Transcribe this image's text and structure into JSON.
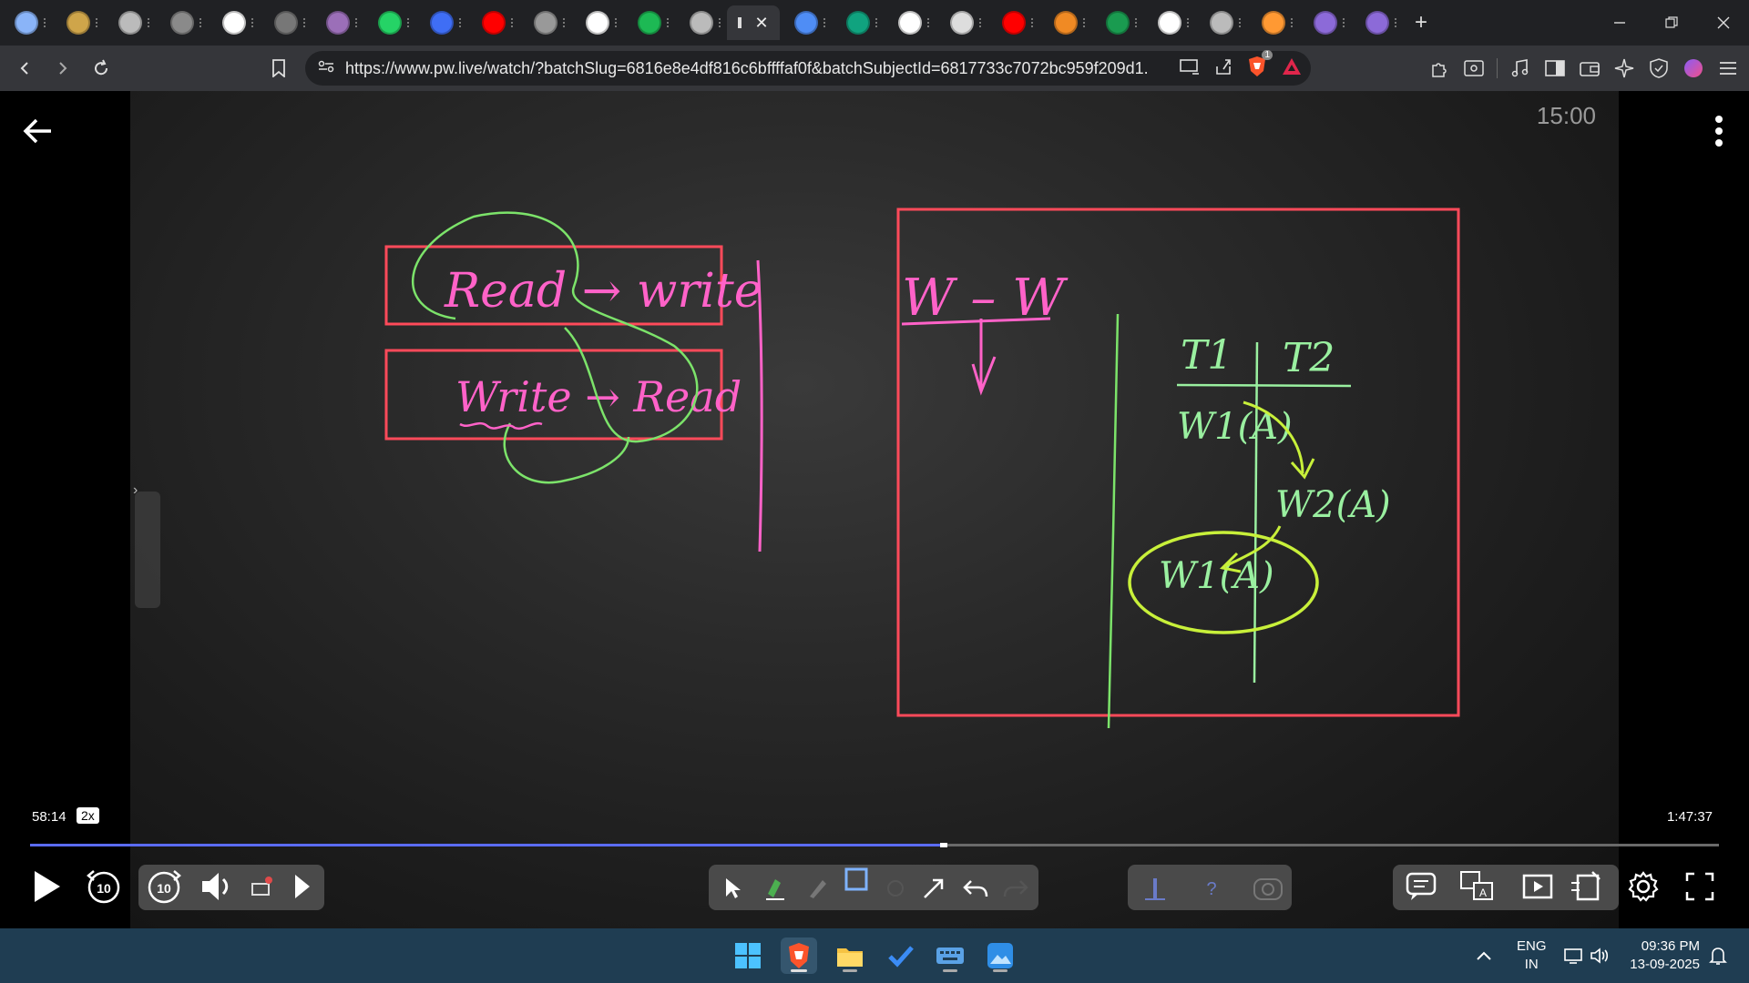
{
  "browser": {
    "tabs": [
      {
        "icon": "generic-site-icon",
        "color": "#8ab4f8"
      },
      {
        "icon": "coin-icon",
        "color": "#cfa54a"
      },
      {
        "icon": "globe-icon",
        "color": "#bbbbbb"
      },
      {
        "icon": "m-site-icon",
        "color": "#8a8a8a"
      },
      {
        "icon": "wordpress-icon",
        "color": "#ffffff"
      },
      {
        "icon": "circle-site-icon",
        "color": "#777777"
      },
      {
        "icon": "avatar-site-icon",
        "color": "#9b6fb8"
      },
      {
        "icon": "whatsapp-icon",
        "color": "#25d366"
      },
      {
        "icon": "shield-tab-icon",
        "color": "#3f6ef5"
      },
      {
        "icon": "youtube-icon",
        "color": "#ff0000"
      },
      {
        "icon": "blog-icon",
        "color": "#999999"
      },
      {
        "icon": "google-icon",
        "color": "#ffffff"
      },
      {
        "icon": "spotify-icon",
        "color": "#1db954"
      },
      {
        "icon": "globe-icon",
        "color": "#bbbbbb"
      },
      {
        "icon": "active-tab",
        "color": "#ffffff",
        "active": true
      },
      {
        "icon": "gemini-icon",
        "color": "#4f8df5"
      },
      {
        "icon": "chatgpt-icon",
        "color": "#10a37f"
      },
      {
        "icon": "google-icon",
        "color": "#ffffff"
      },
      {
        "icon": "window-icon",
        "color": "#dddddd"
      },
      {
        "icon": "youtube-icon",
        "color": "#ff0000"
      },
      {
        "icon": "orange-site-icon",
        "color": "#f08a24"
      },
      {
        "icon": "green-chart-icon",
        "color": "#1a9b50"
      },
      {
        "icon": "wikipedia-icon",
        "color": "#ffffff"
      },
      {
        "icon": "globe-icon",
        "color": "#bbbbbb"
      },
      {
        "icon": "india-flag-icon",
        "color": "#ff9933"
      },
      {
        "icon": "purple-circle-icon",
        "color": "#8c6ad8"
      },
      {
        "icon": "purple-circle-icon",
        "color": "#8c6ad8"
      }
    ],
    "new_tab": "+",
    "url": "https://www.pw.live/watch/?batchSlug=6816e8e4df816c6bffffaf0f&batchSubjectId=6817733c7072bc959f209d1...",
    "ext_badge": "1"
  },
  "player": {
    "countdown": "15:00",
    "current_time": "58:14",
    "speed": "2x",
    "total_time": "1:47:37",
    "progress": 0.54,
    "skip_back": "10",
    "skip_forward": "10"
  },
  "whiteboard": {
    "left_box_1_text": "Read → write",
    "left_box_2_text": "Write → Read",
    "w_w_label": "W – W",
    "t1_label": "T1",
    "t2_label": "T2",
    "w1a_top": "W1(A)",
    "w2a": "W2(A)",
    "w1a_bottom": "W1(A)",
    "colors": {
      "pink": "#ff62c8",
      "red": "#ff4a5a",
      "green": "#7ce36a",
      "lime": "#c8f03a",
      "light_green": "#9af0a0"
    }
  },
  "taskbar": {
    "lang_line1": "ENG",
    "lang_line2": "IN",
    "time": "09:36 PM",
    "date": "13-09-2025"
  }
}
